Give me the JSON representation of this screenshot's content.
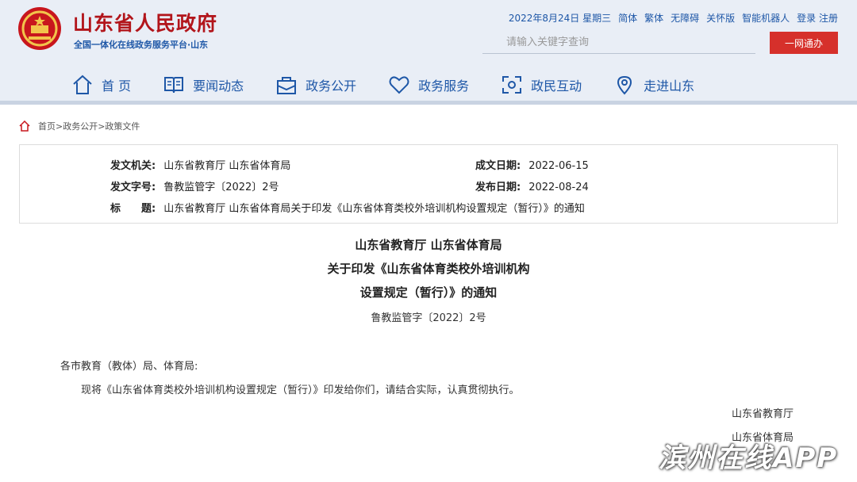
{
  "header": {
    "site_title": "山东省人民政府",
    "site_subtitle": "全国一体化在线政务服务平台·山东",
    "top_links": [
      "2022年8月24日 星期三",
      "简体",
      "繁体",
      "无障碍",
      "关怀版",
      "智能机器人",
      "登录 注册"
    ],
    "search_placeholder": "请输入关键字查询",
    "one_network_label": "一网通办",
    "brand_color": "#b2151b",
    "accent_color": "#1e57a7"
  },
  "nav": [
    {
      "label": "首 页",
      "icon": "home-icon"
    },
    {
      "label": "要闻动态",
      "icon": "news-book-icon"
    },
    {
      "label": "政务公开",
      "icon": "gov-open-icon"
    },
    {
      "label": "政务服务",
      "icon": "heart-icon"
    },
    {
      "label": "政民互动",
      "icon": "interaction-icon"
    },
    {
      "label": "走进山东",
      "icon": "location-icon"
    }
  ],
  "breadcrumb": "首页>政务公开>政策文件",
  "info": {
    "issuer_key": "发文机关:",
    "issuer_val": "山东省教育厅 山东省体育局",
    "doc_no_key": "发文字号:",
    "doc_no_val": "鲁教监管字〔2022〕2号",
    "title_key": "标　　题:",
    "title_val": "山东省教育厅 山东省体育局关于印发《山东省体育类校外培训机构设置规定（暂行）》的通知",
    "written_key": "成文日期:",
    "written_val": "2022-06-15",
    "published_key": "发布日期:",
    "published_val": "2022-08-24"
  },
  "document": {
    "title_line1": "山东省教育厅 山东省体育局",
    "title_line2": "关于印发《山东省体育类校外培训机构",
    "title_line3": "设置规定（暂行）》的通知",
    "doc_no": "鲁教监管字〔2022〕2号",
    "salutation": "各市教育（教体）局、体育局:",
    "body": "现将《山东省体育类校外培训机构设置规定（暂行）》印发给你们，请结合实际，认真贯彻执行。",
    "signature1": "山东省教育厅",
    "signature2": "山东省体育局"
  },
  "watermark": "滨州在线APP"
}
